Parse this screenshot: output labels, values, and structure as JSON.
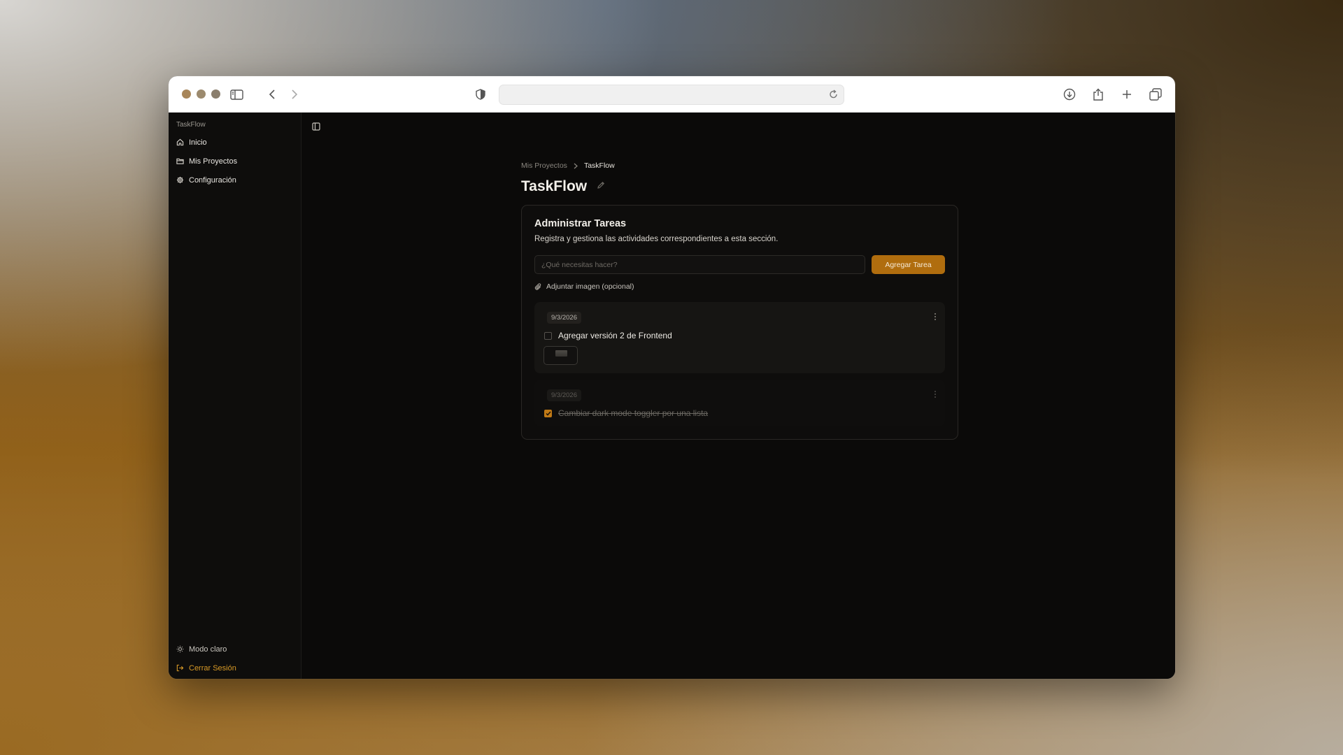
{
  "sidebar": {
    "brand": "TaskFlow",
    "items": [
      {
        "label": "Inicio",
        "icon": "home-icon"
      },
      {
        "label": "Mis Proyectos",
        "icon": "folder-icon"
      },
      {
        "label": "Configuración",
        "icon": "gear-icon"
      }
    ],
    "bottom": {
      "theme_label": "Modo claro",
      "logout_label": "Cerrar Sesión"
    }
  },
  "breadcrumb": {
    "parent": "Mis Proyectos",
    "current": "TaskFlow"
  },
  "page": {
    "title": "TaskFlow"
  },
  "card": {
    "title": "Administrar Tareas",
    "subtitle": "Registra y gestiona las actividades correspondientes a esta sección.",
    "input_placeholder": "¿Qué necesitas hacer?",
    "input_value": "",
    "add_button": "Agregar Tarea",
    "attach_label": "Adjuntar imagen (opcional)"
  },
  "tasks": [
    {
      "date": "9/3/2026",
      "text": "Agregar versión 2 de Frontend",
      "done": false,
      "has_image": true
    },
    {
      "date": "9/3/2026",
      "text": "Cambiar dark mode toggler por una lista",
      "done": true,
      "has_image": false
    }
  ],
  "colors": {
    "accent": "#b06d0e",
    "logout": "#d99a26",
    "background": "#0b0a09"
  }
}
